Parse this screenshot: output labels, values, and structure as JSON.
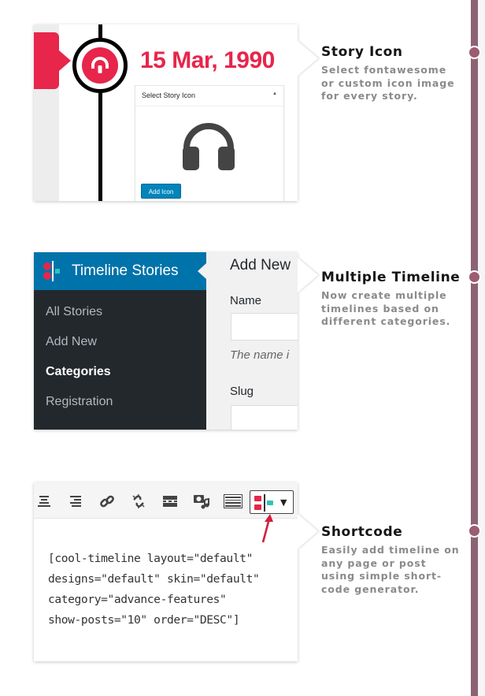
{
  "features": [
    {
      "title": "Story Icon",
      "description": "Select fontawesome or custom icon image for every story."
    },
    {
      "title": "Multiple Timeline",
      "description": "Now create multiple timelines based on different categories."
    },
    {
      "title": "Shortcode",
      "description": "Easily add timeline on any page or post using simple short-code generator."
    }
  ],
  "story_icon_card": {
    "date": "15 Mar, 1990",
    "panel_title": "Select Story Icon",
    "panel_toggle_icon": "triangle-up-icon",
    "selected_icon": "headphones-icon",
    "add_button": "Add Icon"
  },
  "admin_card": {
    "menu_title": "Timeline Stories",
    "menu_icon": "timeline-logo-icon",
    "submenu": [
      {
        "label": "All Stories",
        "active": false
      },
      {
        "label": "Add New",
        "active": false
      },
      {
        "label": "Categories",
        "active": true
      },
      {
        "label": "Registration",
        "active": false
      }
    ],
    "form_title": "Add New",
    "name_label": "Name",
    "name_value": "",
    "name_hint": "The name i",
    "slug_label": "Slug",
    "slug_value": ""
  },
  "shortcode_card": {
    "toolbar_icons": [
      "align-center-icon",
      "align-right-icon",
      "link-icon",
      "unlink-icon",
      "read-more-icon",
      "add-media-icon",
      "keyboard-icon",
      "timeline-shortcode-icon"
    ],
    "code_lines": [
      "[cool-timeline layout=\"default\"",
      "designs=\"default\" skin=\"default\"",
      "category=\"advance-features\"",
      "show-posts=\"10\" order=\"DESC\"]"
    ]
  },
  "colors": {
    "accent_red": "#e8254b",
    "timeline_line": "#8c6375",
    "wp_blue": "#0073aa",
    "wp_dark": "#23282d"
  }
}
